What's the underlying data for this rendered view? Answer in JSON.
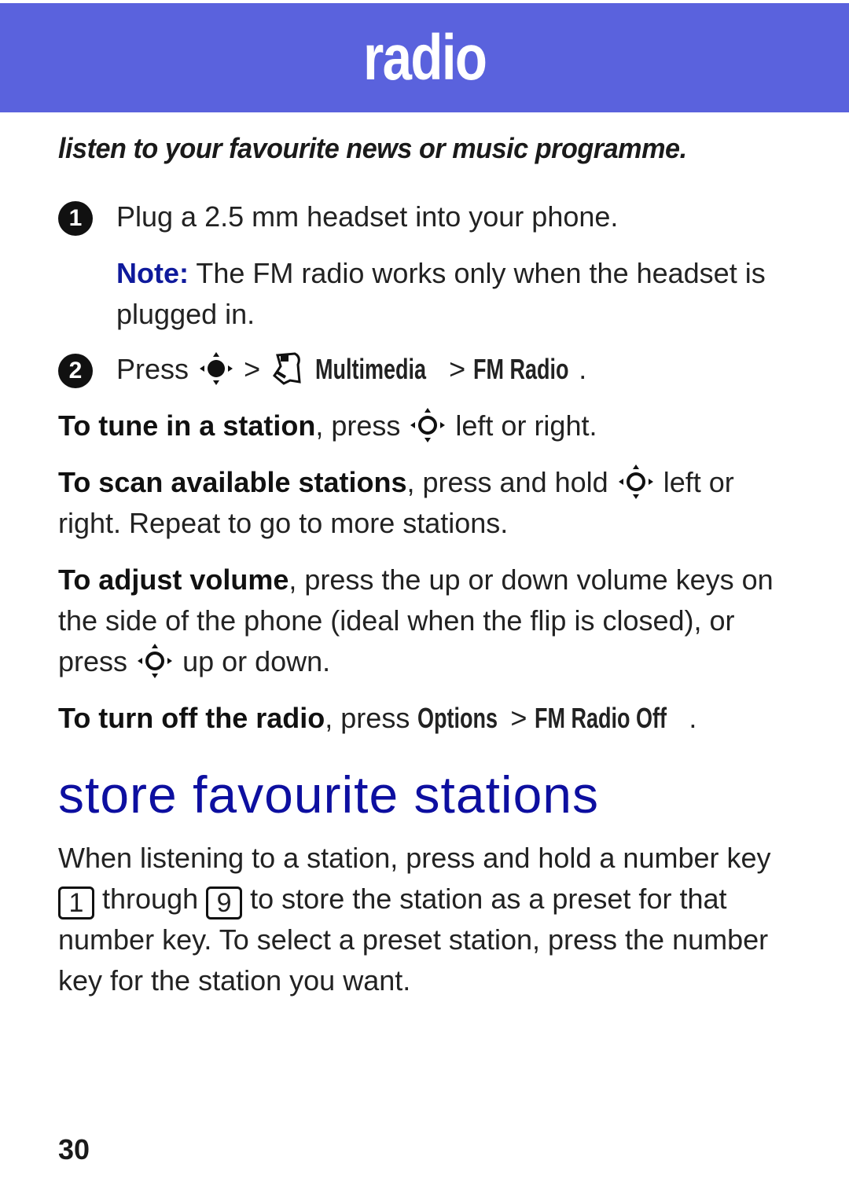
{
  "header": {
    "title": "radio",
    "background_color": "#5a62dd"
  },
  "tagline": "listen to your favourite news or music programme.",
  "steps": [
    {
      "number": "1",
      "text": "Plug a 2.5 mm headset into your phone."
    },
    {
      "number": "2",
      "prefix": "Press",
      "separator": ">",
      "menu_icon": "multimedia-icon",
      "menu_path": [
        "Multimedia",
        "FM Radio"
      ],
      "suffix": "."
    }
  ],
  "note": {
    "label": "Note:",
    "text": "The FM radio works only when the headset is plugged in."
  },
  "instructions": [
    {
      "bold": "To tune in a station",
      "text_before_icon": ", press",
      "icon": "nav-key-icon",
      "text_after_icon": "left or right."
    },
    {
      "bold": "To scan available stations",
      "text_before_icon": ", press and hold",
      "icon": "nav-key-icon",
      "text_after_icon": "left or right. Repeat to go to more stations."
    },
    {
      "bold": "To adjust volume",
      "text_before_icon": ", press the up or down volume keys on the side of the phone (ideal when the flip is closed), or press",
      "icon": "nav-key-icon",
      "text_after_icon": "up or down."
    },
    {
      "bold": "To turn off the radio",
      "text_before": ", press",
      "menu_path": [
        "Options",
        "FM Radio Off"
      ],
      "separator": ">",
      "suffix": "."
    }
  ],
  "section": {
    "title": "store favourite stations",
    "title_color": "#0d0fa0",
    "body_part1": "When listening to a station, press and hold a number key",
    "key_start": "1",
    "through": "through",
    "key_end": "9",
    "body_part2": "to store the station as a preset for that number key. To select a preset station, press the number key for the station you want."
  },
  "page_number": "30"
}
